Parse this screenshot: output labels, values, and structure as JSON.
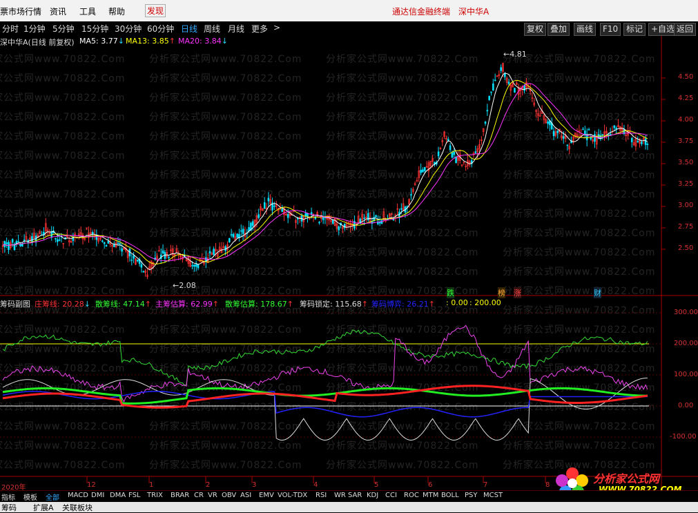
{
  "menu": {
    "title_fragment": "票市场行情",
    "items": [
      "资讯",
      "工具",
      "帮助"
    ],
    "discover": "发现",
    "right_text": "通达信金融终端",
    "stock_label": "深中华A"
  },
  "periods": [
    "分时",
    "1分钟",
    "5分钟",
    "15分钟",
    "30分钟",
    "60分钟",
    "日线",
    "周线",
    "月线",
    "更多"
  ],
  "active_period": "日线",
  "more_arrow": ">",
  "toolbar": [
    "复权",
    "叠加",
    "画线",
    "F10",
    "标记",
    "+自选",
    "返回"
  ],
  "main": {
    "title": "深中华A(日线 前复权)",
    "ma5_label": "MA5: 3.77",
    "ma5_arrow": "↓",
    "ma5_color": "#ffffff",
    "ma13_label": "MA13: 3.85",
    "ma13_arrow": "↑",
    "ma13_color": "#ffff00",
    "ma20_label": "MA20: 3.84",
    "ma20_arrow": "↓",
    "ma20_color": "#ff33ff",
    "high_label": "4.81",
    "low_label": "2.08",
    "y_labels": [
      "4.50",
      "4.25",
      "4.00",
      "3.75",
      "3.50",
      "3.25",
      "3.00",
      "2.75",
      "2.50"
    ],
    "markers": {
      "die": "跌",
      "bang": "榜",
      "zhang": "涨",
      "cai": "财"
    }
  },
  "sub": {
    "title": "筹码副图",
    "items": [
      {
        "text": "庄筹线: 20.28",
        "arrow": "↓",
        "color": "#ff3333"
      },
      {
        "text": "散筹线: 47.14",
        "arrow": "↑",
        "color": "#33ff33"
      },
      {
        "text": "主筹估算: 62.99",
        "arrow": "↑",
        "color": "#ff33ff"
      },
      {
        "text": "散筹估算: 178.67",
        "arrow": "↑",
        "color": "#33ff33"
      },
      {
        "text": "筹码锁定: 115.68",
        "arrow": "↑",
        "color": "#dddddd"
      },
      {
        "text": "筹码博弈: 26.21",
        "arrow": "↑",
        "color": "#2222ff"
      },
      {
        "text": ": 0.00",
        "arrow": "",
        "color": "#ffff00"
      },
      {
        "text": ": 200.00",
        "arrow": "",
        "color": "#ffff00"
      }
    ],
    "y_labels": [
      "300.00",
      "200.00",
      "100.00",
      "0.00",
      "-100.00"
    ]
  },
  "x_axis": [
    "2020年",
    "12",
    "1",
    "2",
    "3",
    "4",
    "5",
    "6",
    "7",
    "8"
  ],
  "tabs": [
    "指标",
    "模板",
    "全部",
    "MACD",
    "DMI",
    "DMA",
    "FSL",
    "TRIX",
    "BRAR",
    "CR",
    "VR",
    "OBV",
    "ASI",
    "EMV",
    "VOL-TDX",
    "RSI",
    "WR",
    "SAR",
    "KDJ",
    "CCI",
    "ROC",
    "MTM",
    "BOLL",
    "PSY",
    "MCST"
  ],
  "active_tab": "全部",
  "bottom": {
    "t1": "筹码",
    "t2": "扩展A",
    "t3": "关联板块"
  },
  "watermark": {
    "text": "分析家公式网www.70822.Com",
    "brand": "分析家公式网",
    "url": "WWW.70822.COM"
  },
  "colors": {
    "up": "#ff3232",
    "down": "#00e0ff",
    "axis": "#aa0000",
    "ma5": "#ffffff",
    "ma13": "#ffff00",
    "ma20": "#ff33ff"
  }
}
